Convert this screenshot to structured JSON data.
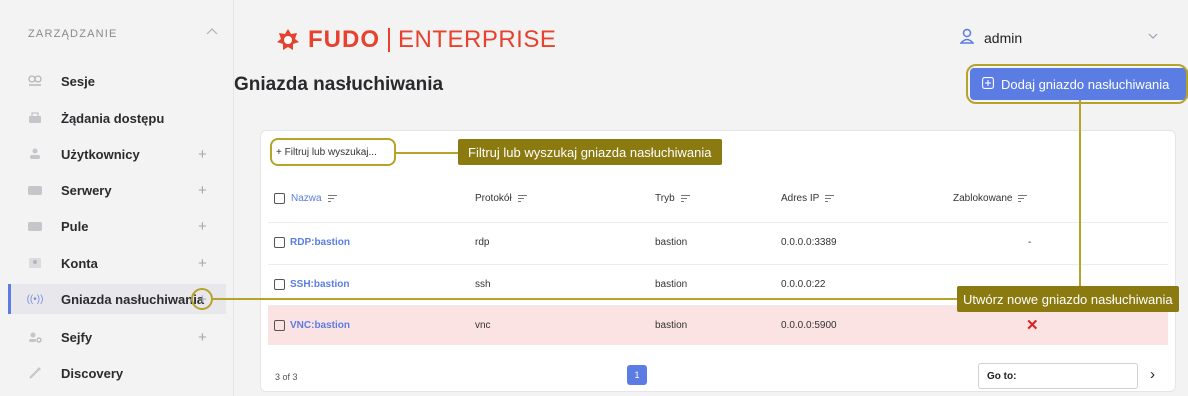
{
  "sidebar": {
    "heading": "ZARZĄDZANIE",
    "items": [
      {
        "label": "Sesje",
        "icon": "sessions-icon",
        "plus": ""
      },
      {
        "label": "Żądania dostępu",
        "icon": "access-request-icon",
        "plus": ""
      },
      {
        "label": "Użytkownicy",
        "icon": "users-icon",
        "plus": "+"
      },
      {
        "label": "Serwery",
        "icon": "servers-icon",
        "plus": "+"
      },
      {
        "label": "Pule",
        "icon": "pools-icon",
        "plus": "+"
      },
      {
        "label": "Konta",
        "icon": "accounts-icon",
        "plus": "+"
      },
      {
        "label": "Gniazda nasłuchiwania",
        "icon": "listener-icon",
        "plus": "+"
      },
      {
        "label": "Sejfy",
        "icon": "safes-icon",
        "plus": "+"
      },
      {
        "label": "Discovery",
        "icon": "discovery-icon",
        "plus": ""
      }
    ]
  },
  "header": {
    "logo_brand": "FUDO",
    "logo_edition": "ENTERPRISE",
    "user_name": "admin"
  },
  "page": {
    "title": "Gniazda nasłuchiwania",
    "add_button": "Dodaj gniazdo nasłuchiwania"
  },
  "filter": {
    "label": "+ Filtruj lub wyszukaj..."
  },
  "callouts": {
    "filter_hint": "Filtruj lub wyszukaj gniazda nasłuchiwania",
    "create_hint": "Utwórz nowe gniazdo nasłuchiwania"
  },
  "table": {
    "columns": [
      "Nazwa",
      "Protokół",
      "Tryb",
      "Adres IP",
      "Zablokowane"
    ],
    "rows": [
      {
        "name": "RDP:bastion",
        "protocol": "rdp",
        "mode": "bastion",
        "ip": "0.0.0.0:3389",
        "blocked": "-"
      },
      {
        "name": "SSH:bastion",
        "protocol": "ssh",
        "mode": "bastion",
        "ip": "0.0.0.0:22",
        "blocked": ""
      },
      {
        "name": "VNC:bastion",
        "protocol": "vnc",
        "mode": "bastion",
        "ip": "0.0.0.0:5900",
        "blocked": "✕"
      }
    ]
  },
  "footer": {
    "count": "3 of 3",
    "page": "1",
    "goto_label": "Go to:",
    "next": "›"
  },
  "colors": {
    "accent": "#5b7de3",
    "brand": "#e8412d",
    "callout": "#8a7a10",
    "alert_row": "#fce3e3"
  }
}
